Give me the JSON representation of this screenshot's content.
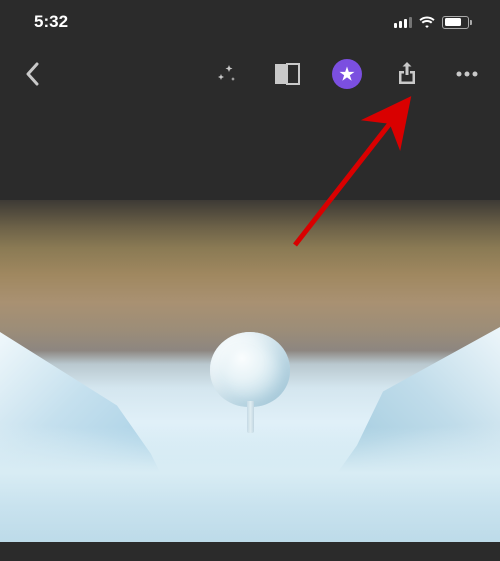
{
  "status": {
    "time": "5:32"
  },
  "annotation": {
    "color": "#d90000"
  },
  "colors": {
    "toolbar_bg": "#2b2b2b",
    "favorite_accent": "#7b4fe0"
  }
}
